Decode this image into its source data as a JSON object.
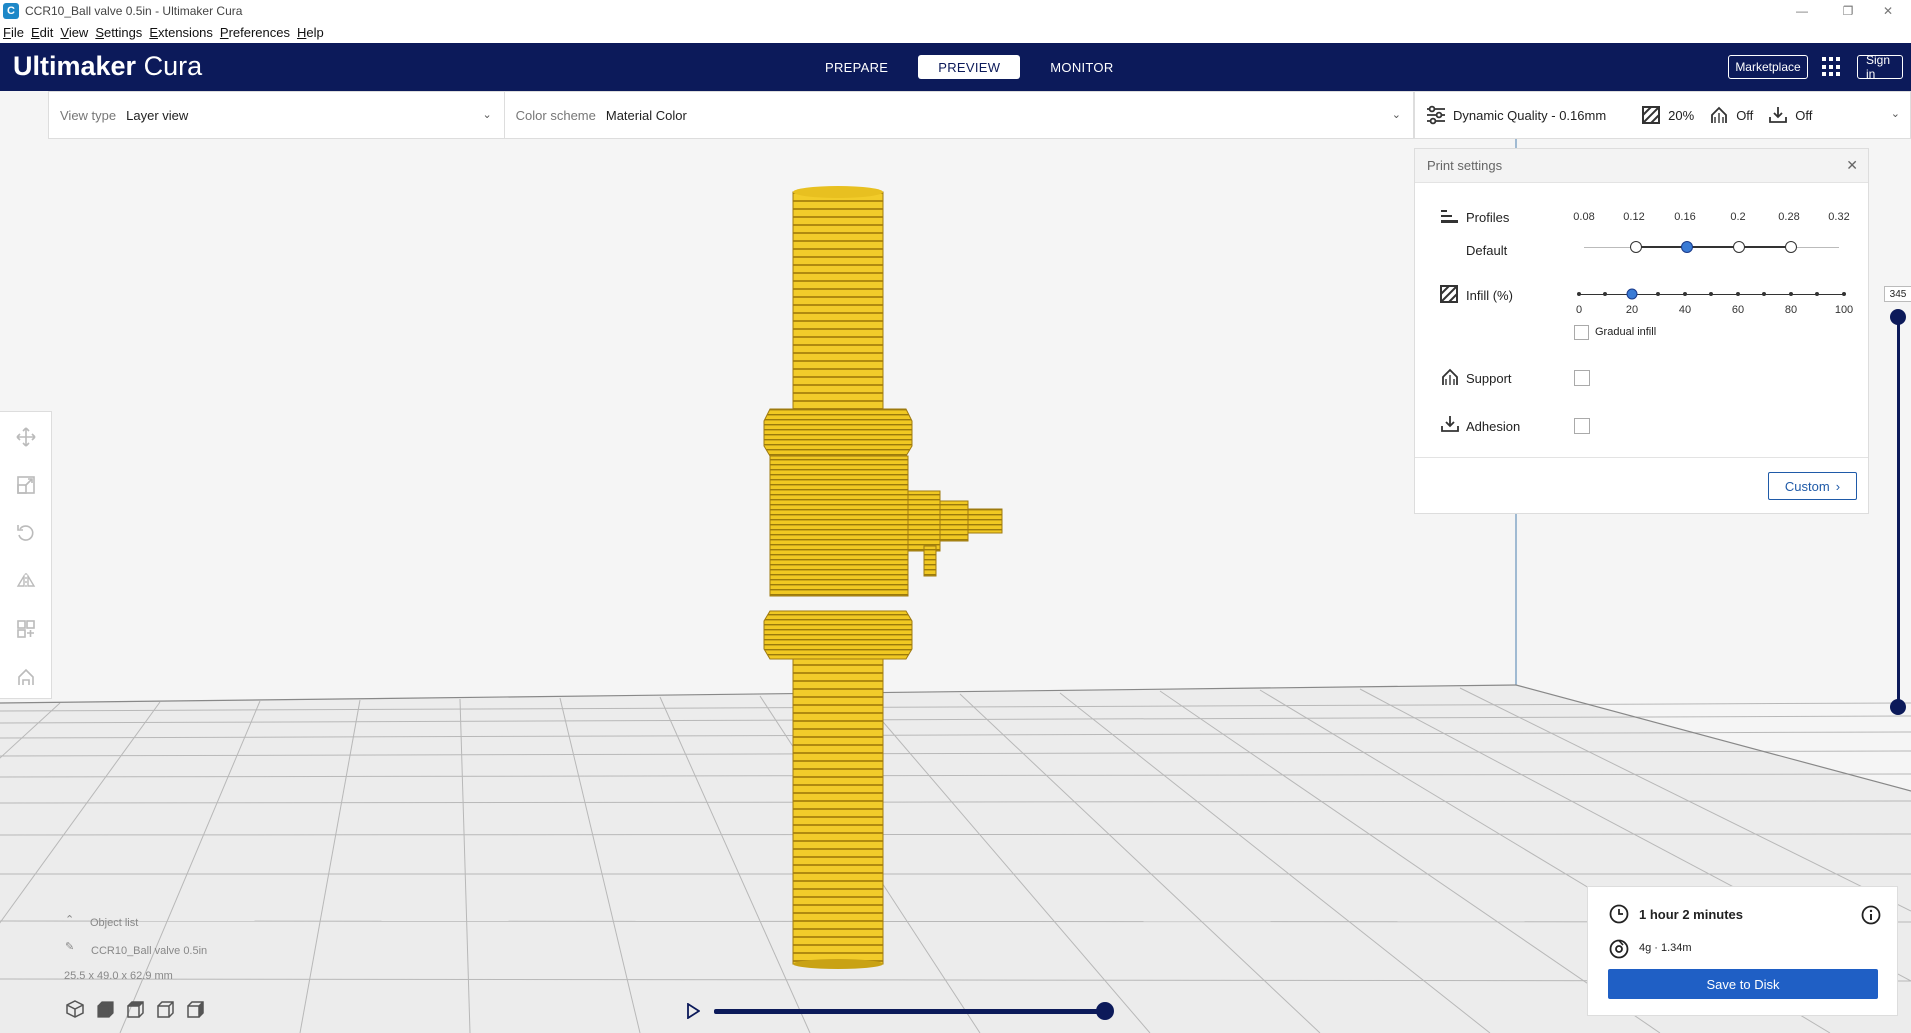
{
  "window": {
    "title": "CCR10_Ball valve 0.5in - Ultimaker Cura",
    "app_icon": "C",
    "controls": [
      "—",
      "❐",
      "✕"
    ]
  },
  "menu": [
    "File",
    "Edit",
    "View",
    "Settings",
    "Extensions",
    "Preferences",
    "Help"
  ],
  "header": {
    "logo_bold": "Ultimaker",
    "logo_light": " Cura",
    "tabs": [
      "PREPARE",
      "PREVIEW",
      "MONITOR"
    ],
    "active_tab": "PREVIEW",
    "marketplace": "Marketplace",
    "sign_in": "Sign in"
  },
  "view_bar": {
    "view_type_label": "View type",
    "view_type_value": "Layer view",
    "color_scheme_label": "Color scheme",
    "color_scheme_value": "Material Color"
  },
  "settings_bar": {
    "profile": "Dynamic Quality - 0.16mm",
    "infill": "20%",
    "support": "Off",
    "adhesion": "Off"
  },
  "print_settings": {
    "title": "Print settings",
    "profiles_label": "Profiles",
    "profile_default": "Default",
    "profile_ticks": [
      "0.08",
      "0.12",
      "0.16",
      "0.2",
      "0.28",
      "0.32"
    ],
    "profile_selected": "0.16",
    "infill_label": "Infill (%)",
    "infill_ticks": [
      "0",
      "20",
      "40",
      "60",
      "80",
      "100"
    ],
    "infill_value": 20,
    "gradual_infill": "Gradual infill",
    "support_label": "Support",
    "adhesion_label": "Adhesion",
    "custom_button": "Custom"
  },
  "layer": {
    "current": "345"
  },
  "object": {
    "list_label": "Object list",
    "name": "CCR10_Ball valve 0.5in",
    "dimensions": "25.5 x 49.0 x 62.9 mm"
  },
  "estimate": {
    "time": "1 hour 2 minutes",
    "material": "4g · 1.34m",
    "save_button": "Save to Disk"
  },
  "colors": {
    "header_bg": "#0c1a5a",
    "accent": "#1f5fc5",
    "model": "#f2cc2a"
  }
}
